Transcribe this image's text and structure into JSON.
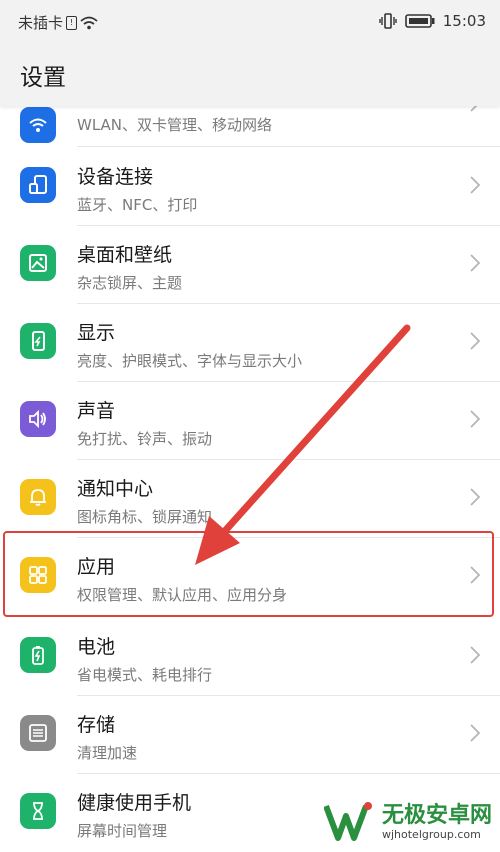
{
  "status_bar": {
    "carrier": "未插卡",
    "time": "15:03"
  },
  "header": {
    "title": "设置"
  },
  "items": [
    {
      "title": "",
      "subtitle": "WLAN、双卡管理、移动网络",
      "icon": "wifi-icon",
      "color": "#1e6fe6"
    },
    {
      "title": "设备连接",
      "subtitle": "蓝牙、NFC、打印",
      "icon": "device-connection-icon",
      "color": "#1e6fe6"
    },
    {
      "title": "桌面和壁纸",
      "subtitle": "杂志锁屏、主题",
      "icon": "wallpaper-icon",
      "color": "#1fb26b"
    },
    {
      "title": "显示",
      "subtitle": "亮度、护眼模式、字体与显示大小",
      "icon": "display-icon",
      "color": "#1fb26b"
    },
    {
      "title": "声音",
      "subtitle": "免打扰、铃声、振动",
      "icon": "sound-icon",
      "color": "#7b5bd6"
    },
    {
      "title": "通知中心",
      "subtitle": "图标角标、锁屏通知",
      "icon": "bell-icon",
      "color": "#f5c21b"
    },
    {
      "title": "应用",
      "subtitle": "权限管理、默认应用、应用分身",
      "icon": "apps-icon",
      "color": "#f5c21b"
    },
    {
      "title": "电池",
      "subtitle": "省电模式、耗电排行",
      "icon": "battery-icon",
      "color": "#1fb26b"
    },
    {
      "title": "存储",
      "subtitle": "清理加速",
      "icon": "storage-icon",
      "color": "#8a8a8a"
    },
    {
      "title": "健康使用手机",
      "subtitle": "屏幕时间管理",
      "icon": "hourglass-icon",
      "color": "#1fb26b"
    }
  ],
  "watermark": {
    "title": "无极安卓网",
    "url": "wjhotelgroup.com"
  }
}
